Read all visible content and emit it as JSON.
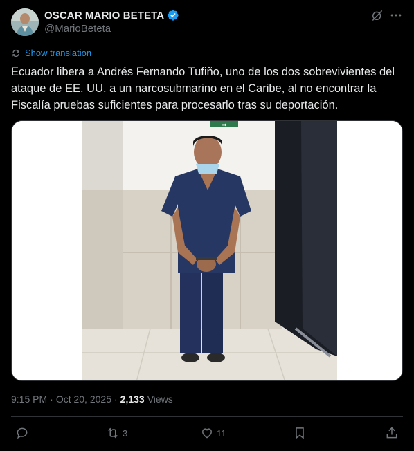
{
  "author": {
    "display_name": "OSCAR MARIO BETETA",
    "handle": "@MarioBeteta",
    "verified": true,
    "avatar_icon": "profile-photo"
  },
  "translation": {
    "label": "Show translation"
  },
  "post": {
    "text": "Ecuador libera a Andrés Fernando Tufiño, uno de los dos sobrevivientes del ataque de EE. UU. a un narcosubmarino en el Caribe, al no encontrar la Fiscalía pruebas suficientes para procesarlo tras su deportación."
  },
  "media": {
    "sign_text": "➡",
    "description_icon": "photo-man-in-blue-uniform-handcuffed"
  },
  "meta": {
    "time": "9:15 PM",
    "date": "Oct 20, 2025",
    "separator": "·",
    "views_count": "2,133",
    "views_label": "Views"
  },
  "actions": {
    "reply_count": "",
    "repost_count": "3",
    "like_count": "11"
  },
  "colors": {
    "background": "#000000",
    "text": "#e7e9ea",
    "muted": "#71767b",
    "accent": "#1d9bf0",
    "border": "#2f3336"
  }
}
